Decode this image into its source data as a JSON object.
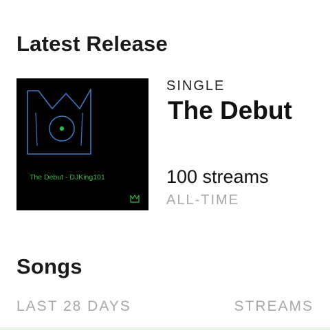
{
  "latest_release": {
    "section_title": "Latest Release",
    "cover": {
      "caption": "The Debut - DJKing101",
      "crown_color": "#3a7bbf",
      "dot_color": "#2fb84a",
      "caption_color": "#3fb34f"
    },
    "type": "SINGLE",
    "title": "The Debut",
    "streams": "100 streams",
    "streams_period": "ALL-TIME"
  },
  "songs": {
    "section_title": "Songs",
    "column_left": "LAST 28 DAYS",
    "column_right": "STREAMS"
  }
}
